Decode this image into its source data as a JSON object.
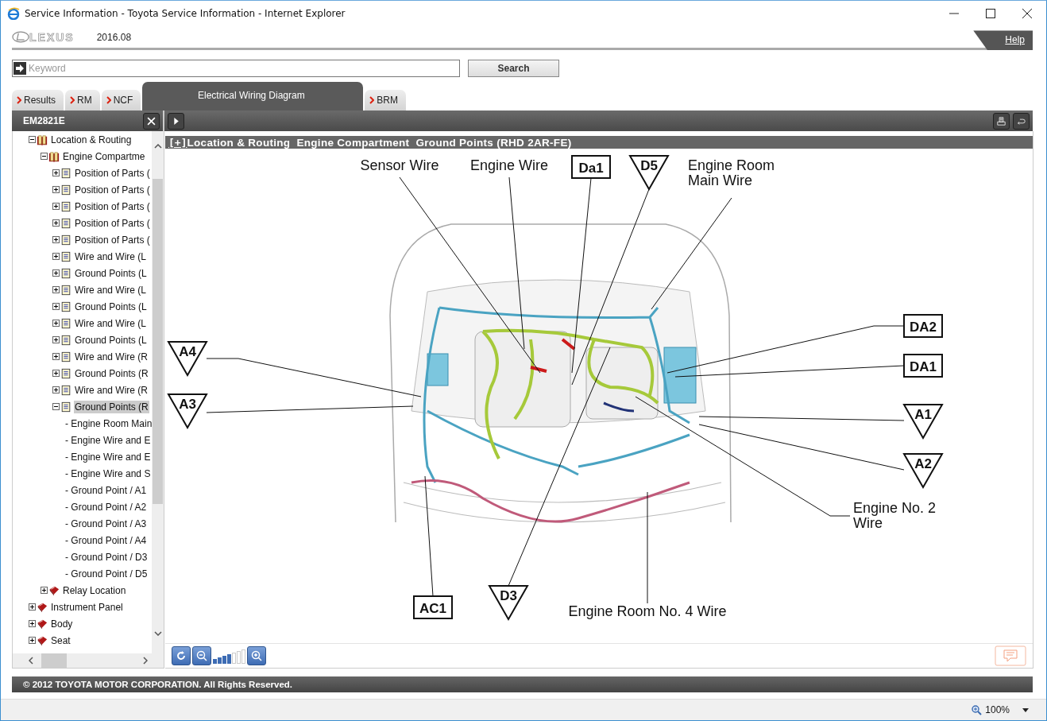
{
  "window": {
    "title": "Service Information - Toyota Service Information - Internet Explorer"
  },
  "header": {
    "brand": "LEXUS",
    "version": "2016.08",
    "help": "Help"
  },
  "search": {
    "placeholder": "Keyword",
    "button": "Search"
  },
  "tabs": [
    {
      "label": "Results",
      "selected": false
    },
    {
      "label": "RM",
      "selected": false
    },
    {
      "label": "NCF",
      "selected": false
    },
    {
      "label": "Electrical Wiring Diagram",
      "selected": true
    },
    {
      "label": "BRM",
      "selected": false
    }
  ],
  "panel": {
    "code": "EM2821E"
  },
  "tree": [
    {
      "label": "Location & Routing",
      "kind": "book_open",
      "expanded": true,
      "selected": false,
      "children": [
        {
          "label": "Engine Compartme",
          "kind": "book_open",
          "expanded": true,
          "selected": false,
          "children": [
            {
              "label": "Position of Parts (",
              "kind": "page",
              "expanded": false,
              "selected": false
            },
            {
              "label": "Position of Parts (",
              "kind": "page",
              "expanded": false,
              "selected": false
            },
            {
              "label": "Position of Parts (",
              "kind": "page",
              "expanded": false,
              "selected": false
            },
            {
              "label": "Position of Parts (",
              "kind": "page",
              "expanded": false,
              "selected": false
            },
            {
              "label": "Position of Parts (",
              "kind": "page",
              "expanded": false,
              "selected": false
            },
            {
              "label": "Wire and Wire (L",
              "kind": "page",
              "expanded": false,
              "selected": false
            },
            {
              "label": "Ground Points (L",
              "kind": "page",
              "expanded": false,
              "selected": false
            },
            {
              "label": "Wire and Wire (L",
              "kind": "page",
              "expanded": false,
              "selected": false
            },
            {
              "label": "Ground Points (L",
              "kind": "page",
              "expanded": false,
              "selected": false
            },
            {
              "label": "Wire and Wire (L",
              "kind": "page",
              "expanded": false,
              "selected": false
            },
            {
              "label": "Ground Points (L",
              "kind": "page",
              "expanded": false,
              "selected": false
            },
            {
              "label": "Wire and Wire (R",
              "kind": "page",
              "expanded": false,
              "selected": false
            },
            {
              "label": "Ground Points (R",
              "kind": "page",
              "expanded": false,
              "selected": false
            },
            {
              "label": "Wire and Wire (R",
              "kind": "page",
              "expanded": false,
              "selected": false
            },
            {
              "label": "Ground Points (R",
              "kind": "page",
              "expanded": true,
              "selected": true,
              "children": [
                {
                  "label": "- Engine Room Main",
                  "kind": "leaf",
                  "selected": false
                },
                {
                  "label": "- Engine Wire and E",
                  "kind": "leaf",
                  "selected": false
                },
                {
                  "label": "- Engine Wire and E",
                  "kind": "leaf",
                  "selected": false
                },
                {
                  "label": "- Engine Wire and S",
                  "kind": "leaf",
                  "selected": false
                },
                {
                  "label": "- Ground Point / A1",
                  "kind": "leaf",
                  "selected": false
                },
                {
                  "label": "- Ground Point / A2",
                  "kind": "leaf",
                  "selected": false
                },
                {
                  "label": "- Ground Point / A3",
                  "kind": "leaf",
                  "selected": false
                },
                {
                  "label": "- Ground Point / A4",
                  "kind": "leaf",
                  "selected": false
                },
                {
                  "label": "- Ground Point / D3",
                  "kind": "leaf",
                  "selected": false
                },
                {
                  "label": "- Ground Point / D5",
                  "kind": "leaf",
                  "selected": false
                }
              ]
            }
          ]
        },
        {
          "label": "Relay Location",
          "kind": "book_red",
          "expanded": false,
          "selected": false
        }
      ]
    },
    {
      "label": "Instrument Panel",
      "kind": "book_red",
      "expanded": false,
      "selected": false
    },
    {
      "label": "Body",
      "kind": "book_red",
      "expanded": false,
      "selected": false
    },
    {
      "label": "Seat",
      "kind": "book_red",
      "expanded": false,
      "selected": false
    }
  ],
  "document": {
    "toggle": "[+]",
    "title": "Location & Routing  Engine Compartment  Ground Points (RHD 2AR-FE)"
  },
  "diagram": {
    "labels": [
      {
        "kind": "text",
        "lines": [
          "Sensor Wire"
        ]
      },
      {
        "kind": "text",
        "lines": [
          "Engine Wire"
        ]
      },
      {
        "kind": "box",
        "lines": [
          "Da1"
        ]
      },
      {
        "kind": "triangle",
        "lines": [
          "D5"
        ]
      },
      {
        "kind": "text",
        "lines": [
          "Engine Room",
          "Main Wire"
        ]
      },
      {
        "kind": "box",
        "lines": [
          "DA2"
        ]
      },
      {
        "kind": "box",
        "lines": [
          "DA1"
        ]
      },
      {
        "kind": "triangle",
        "lines": [
          "A4"
        ]
      },
      {
        "kind": "triangle",
        "lines": [
          "A3"
        ]
      },
      {
        "kind": "triangle",
        "lines": [
          "A1"
        ]
      },
      {
        "kind": "triangle",
        "lines": [
          "A2"
        ]
      },
      {
        "kind": "text",
        "lines": [
          "Engine No. 2",
          "Wire"
        ]
      },
      {
        "kind": "box",
        "lines": [
          "AC1"
        ]
      },
      {
        "kind": "triangle",
        "lines": [
          "D3"
        ]
      },
      {
        "kind": "text",
        "lines": [
          "Engine Room No. 4 Wire"
        ]
      }
    ]
  },
  "zoom": {
    "level": 0.57
  },
  "footer": {
    "copyright": "© 2012 TOYOTA MOTOR CORPORATION. All Rights Reserved."
  },
  "status_bar": {
    "zoom": "100%"
  }
}
